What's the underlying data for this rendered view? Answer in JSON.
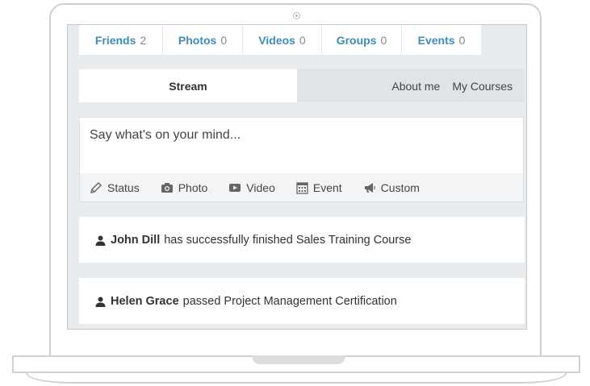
{
  "stats": [
    {
      "label": "Friends",
      "count": "2"
    },
    {
      "label": "Photos",
      "count": "0"
    },
    {
      "label": "Videos",
      "count": "0"
    },
    {
      "label": "Groups",
      "count": "0"
    },
    {
      "label": "Events",
      "count": "0"
    }
  ],
  "tabs": {
    "stream": "Stream",
    "about": "About me",
    "courses": "My Courses"
  },
  "composer": {
    "placeholder": "Say what's on your mind...",
    "actions": [
      {
        "label": "Status",
        "icon": "pencil-icon"
      },
      {
        "label": "Photo",
        "icon": "camera-icon"
      },
      {
        "label": "Video",
        "icon": "video-icon"
      },
      {
        "label": "Event",
        "icon": "calendar-icon"
      },
      {
        "label": "Custom",
        "icon": "megaphone-icon"
      }
    ]
  },
  "feed": [
    {
      "name": "John Dill",
      "text": "has successfully finished Sales Training Course"
    },
    {
      "name": "Helen Grace",
      "text": "passed Project Management Certification"
    }
  ],
  "colors": {
    "accent": "#3c8dbc",
    "background": "#e9ecee",
    "tab_inactive": "#dfe4e7"
  }
}
